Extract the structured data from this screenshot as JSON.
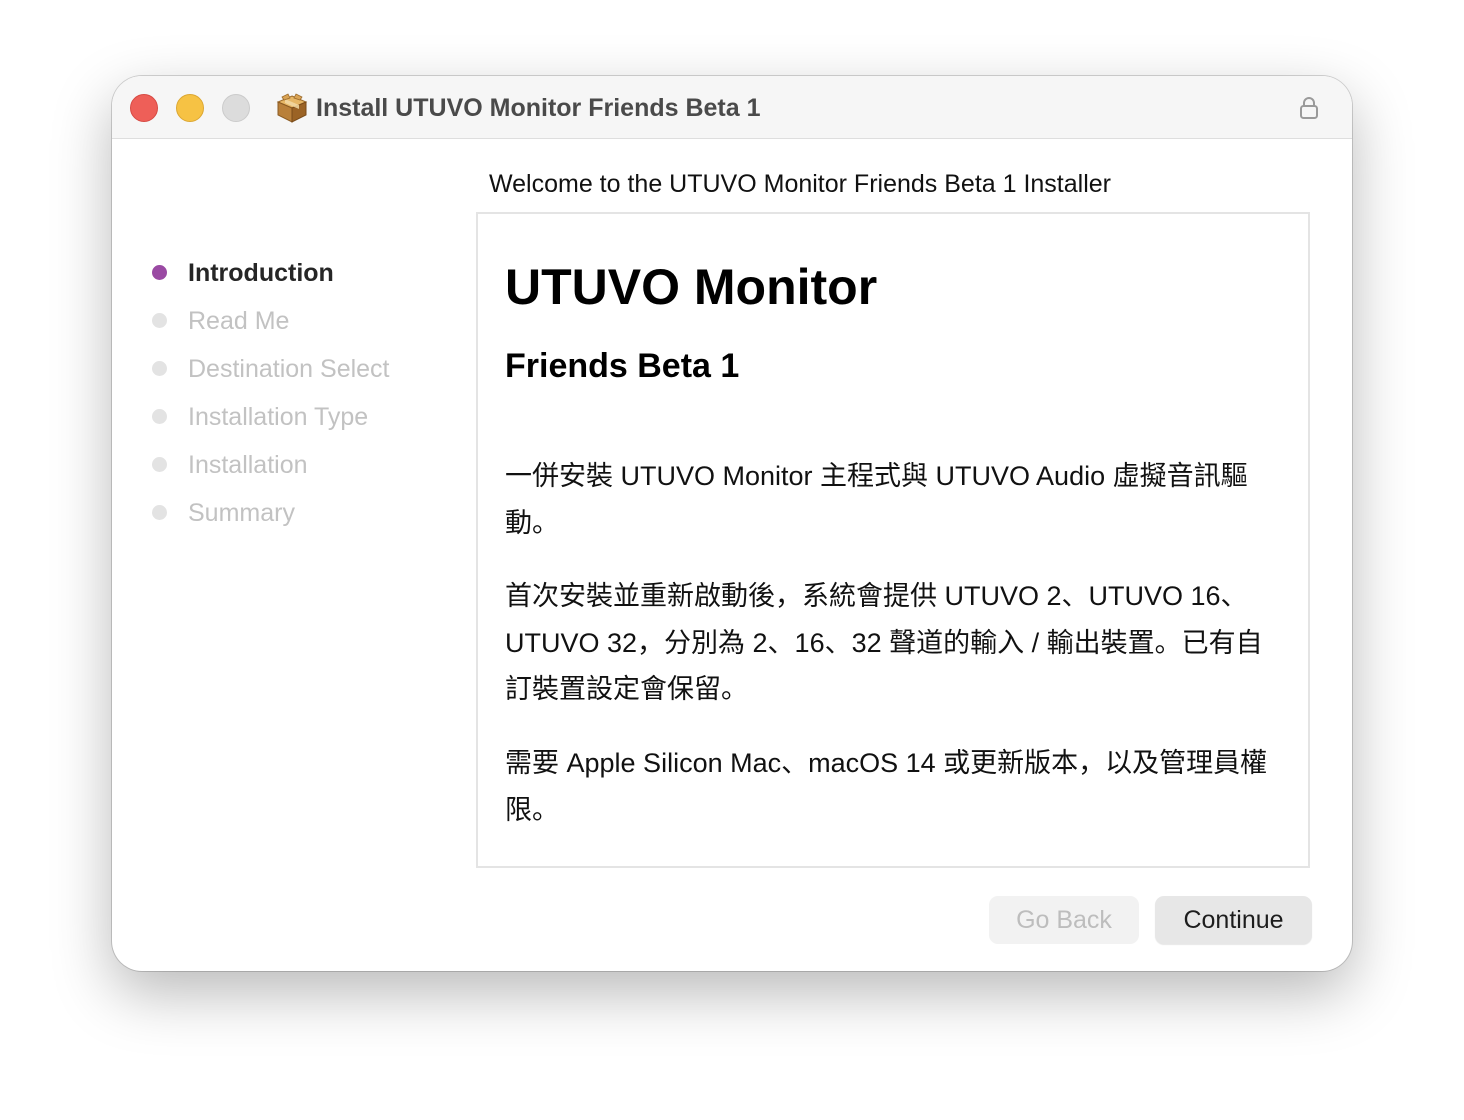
{
  "window": {
    "title": "Install UTUVO Monitor Friends Beta 1",
    "icon": "package-icon",
    "lock_icon": "lock-icon"
  },
  "header": {
    "welcome": "Welcome to the UTUVO Monitor Friends Beta 1 Installer"
  },
  "steps": [
    {
      "label": "Introduction",
      "active": true
    },
    {
      "label": "Read Me",
      "active": false
    },
    {
      "label": "Destination Select",
      "active": false
    },
    {
      "label": "Installation Type",
      "active": false
    },
    {
      "label": "Installation",
      "active": false
    },
    {
      "label": "Summary",
      "active": false
    }
  ],
  "content": {
    "heading": "UTUVO Monitor",
    "subheading": "Friends Beta 1",
    "paragraphs": [
      "一併安裝 UTUVO Monitor 主程式與 UTUVO Audio 虛擬音訊驅動。",
      "首次安裝並重新啟動後，系統會提供 UTUVO 2、UTUVO 16、UTUVO 32，分別為 2、16、32 聲道的輸入 / 輸出裝置。已有自訂裝置設定會保留。",
      "需要 Apple Silicon Mac、macOS 14 或更新版本，以及管理員權限。"
    ]
  },
  "buttons": {
    "go_back": "Go Back",
    "continue": "Continue"
  },
  "colors": {
    "active_step_dot": "#9a4aa3",
    "close": "#ee5f58",
    "minimize": "#f6c244",
    "zoom_inactive": "#dcdcdc"
  }
}
